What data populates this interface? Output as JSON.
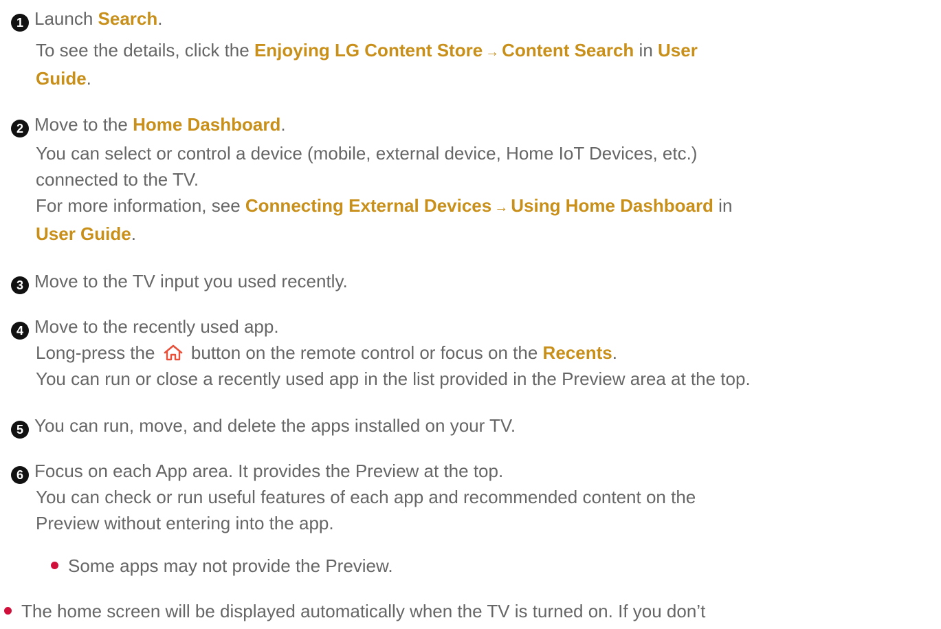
{
  "items": [
    {
      "number": "1",
      "line1": {
        "pre": "Launch ",
        "b1": "Search",
        "post": "."
      },
      "line2": {
        "pre": "To see the details, click the ",
        "b1": "Enjoying LG Content Store",
        "b2": "Content Search",
        "mid": " in ",
        "b3": "User"
      },
      "line3": {
        "b1": "Guide",
        "post": "."
      }
    },
    {
      "number": "2",
      "line1": {
        "pre": "Move to the ",
        "b1": "Home Dashboard",
        "post": "."
      },
      "line2": "You can select or control a device (mobile, external device, Home IoT Devices, etc.)",
      "line3": "connected to the TV.",
      "line4": {
        "pre": "For more information, see ",
        "b1": "Connecting External Devices",
        "b2": "Using Home Dashboard",
        "mid": " in"
      },
      "line5": {
        "b1": "User Guide",
        "post": "."
      }
    },
    {
      "number": "3",
      "line1": "Move to the TV input you used recently."
    },
    {
      "number": "4",
      "line1": "Move to the recently used app.",
      "line2": {
        "pre": "Long-press the ",
        "mid": " button on the remote control or focus on the ",
        "b1": "Recents",
        "post": "."
      },
      "line3": "You can run or close a recently used app in the list provided in the Preview area at the top."
    },
    {
      "number": "5",
      "line1": "You can run, move, and delete the apps installed on your TV."
    },
    {
      "number": "6",
      "line1": "Focus on each App area. It provides the Preview at the top.",
      "line2": "You can check or run useful features of each app and recommended content on the",
      "line3": "Preview without entering into the app.",
      "sub_bullet": "Some apps may not provide the Preview."
    }
  ],
  "footer_bullet": "The home screen will be displayed automatically when the TV is turned on. If you don’t",
  "colors": {
    "text": "#666666",
    "highlight": "#c8901a",
    "bullet": "#d0103a",
    "number_badge": "#111111",
    "home_icon": "#e8503a"
  },
  "icons": {
    "home": "home-icon",
    "arrow": "right-arrow-icon"
  },
  "arrow_glyph": "→"
}
